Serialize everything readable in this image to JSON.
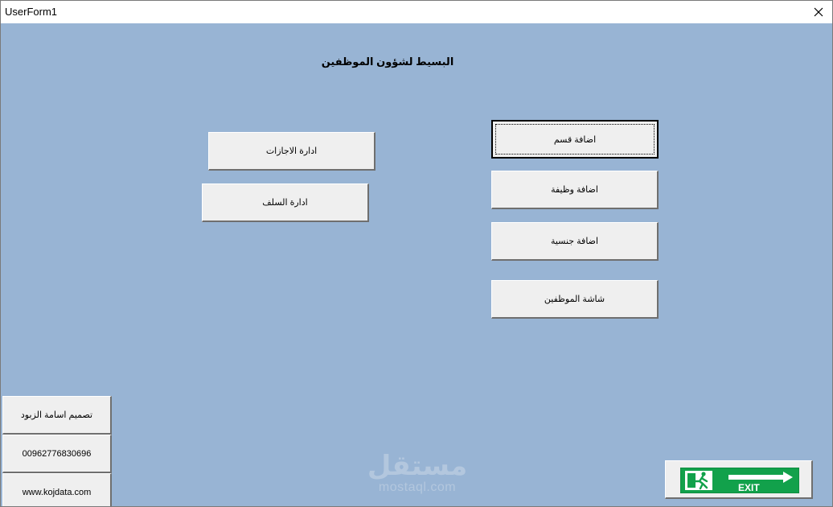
{
  "window": {
    "title": "UserForm1"
  },
  "form": {
    "heading": "البسيط لشؤون الموظفين",
    "buttons": {
      "add_department": "اضافة قسم",
      "add_job": "اضافة وظيفة",
      "add_nationality": "اضافة جنسية",
      "employees_screen": "شاشة الموظفين",
      "manage_leaves": "ادارة الاجازات",
      "manage_advances": "ادارة السلف"
    },
    "info": {
      "designer": "تصميم اسامة الزبود",
      "phone": "00962776830696",
      "website": "www.kojdata.com"
    },
    "exit_label": "EXIT"
  },
  "watermark": {
    "arabic": "مستقل",
    "latin": "mostaql.com"
  },
  "colors": {
    "form_background": "#98b4d4",
    "button_face": "#efefef",
    "exit_green": "#12a14b"
  }
}
